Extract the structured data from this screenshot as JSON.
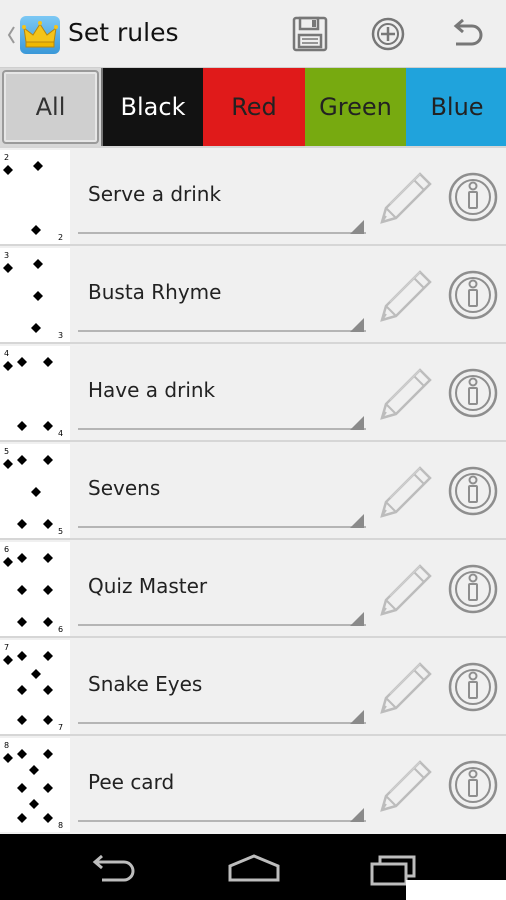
{
  "header": {
    "title": "Set rules"
  },
  "tabs": [
    {
      "label": "All",
      "key": "all",
      "selected": true
    },
    {
      "label": "Black",
      "key": "black"
    },
    {
      "label": "Red",
      "key": "red"
    },
    {
      "label": "Green",
      "key": "green"
    },
    {
      "label": "Blue",
      "key": "blue"
    }
  ],
  "rules": [
    {
      "card": "2",
      "name": "Serve a drink"
    },
    {
      "card": "3",
      "name": "Busta Rhyme"
    },
    {
      "card": "4",
      "name": "Have a drink"
    },
    {
      "card": "5",
      "name": "Sevens"
    },
    {
      "card": "6",
      "name": "Quiz Master"
    },
    {
      "card": "7",
      "name": "Snake Eyes"
    },
    {
      "card": "8",
      "name": "Pee card"
    }
  ],
  "icons": {
    "save": "floppy-disk-icon",
    "add": "add-circle-icon",
    "undo": "undo-icon",
    "edit": "pencil-icon",
    "info": "info-icon"
  },
  "colors": {
    "black_tab": "#121212",
    "red_tab": "#e01a1a",
    "green_tab": "#77aa10",
    "blue_tab": "#20a3dc"
  }
}
